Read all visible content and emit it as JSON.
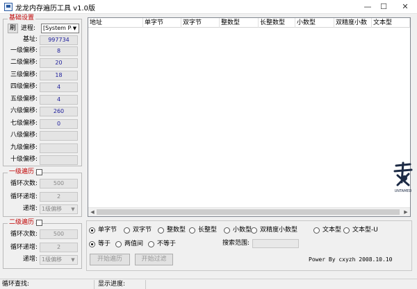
{
  "window": {
    "title": "龙龙内存遍历工具 v1.0版",
    "minimize": "—",
    "maximize": "☐",
    "close": "✕"
  },
  "basic": {
    "group_title": "基础设置",
    "refresh_label": "刷",
    "process_label": "进程:",
    "process_value": "[System Pr",
    "base_label": "基址:",
    "base_value": "997734",
    "offsets": [
      {
        "label": "一级偏移:",
        "value": "8"
      },
      {
        "label": "二级偏移:",
        "value": "20"
      },
      {
        "label": "三级偏移:",
        "value": "18"
      },
      {
        "label": "四级偏移:",
        "value": "4"
      },
      {
        "label": "五级偏移:",
        "value": "4"
      },
      {
        "label": "六级偏移:",
        "value": "260"
      },
      {
        "label": "七级偏移:",
        "value": "0"
      },
      {
        "label": "八级偏移:",
        "value": ""
      },
      {
        "label": "九级偏移:",
        "value": ""
      },
      {
        "label": "十级偏移:",
        "value": ""
      }
    ]
  },
  "level1": {
    "group_title": "一级遍历",
    "loop_label": "循环次数:",
    "loop_value": "500",
    "step_label": "循环递增:",
    "step_value": "2",
    "increment_label": "递增:",
    "increment_value": "1级偏移"
  },
  "level2": {
    "group_title": "二级遍历",
    "loop_label": "循环次数:",
    "loop_value": "500",
    "step_label": "循环递增:",
    "step_value": "2",
    "increment_label": "递增:",
    "increment_value": "1级偏移"
  },
  "list": {
    "columns": [
      "地址",
      "单字节",
      "双字节",
      "整数型",
      "长整数型",
      "小数型",
      "双精度小数",
      "文本型"
    ]
  },
  "types": [
    "单字节",
    "双字节",
    "整数型",
    "长整型",
    "小数型",
    "双精度小数型",
    "文本型",
    "文本型-U"
  ],
  "selected_type": "单字节",
  "compare": [
    "等于",
    "两值间",
    "不等于"
  ],
  "selected_compare": "等于",
  "search_range_label": "搜索范围:",
  "search_range_value": "",
  "buttons": {
    "start_traverse": "开始遍历",
    "start_filter": "开始过滤"
  },
  "credit": "Power By cxyzh 2008.10.10",
  "logo_text": "UNTAMED",
  "status": {
    "loop_search": "循环查找:",
    "show_progress": "显示进度:"
  }
}
